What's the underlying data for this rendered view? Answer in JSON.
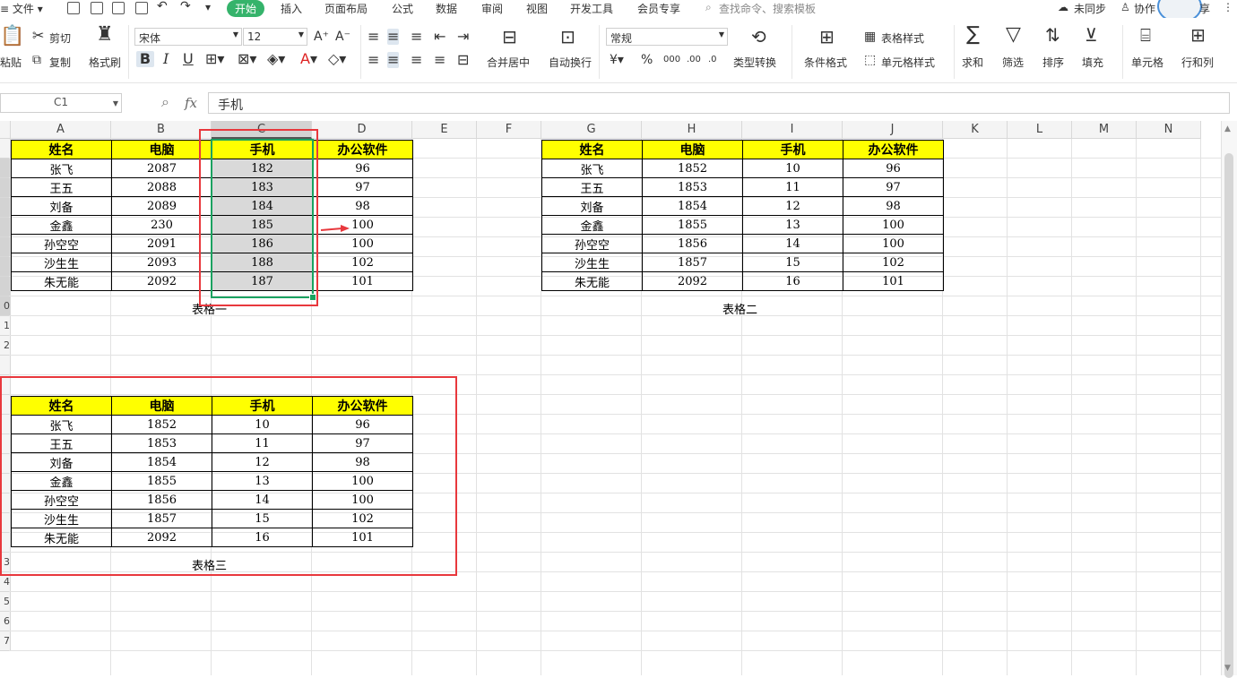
{
  "menubar": {
    "file": "文件",
    "tabs": [
      "开始",
      "插入",
      "页面布局",
      "公式",
      "数据",
      "审阅",
      "视图",
      "开发工具",
      "会员专享"
    ],
    "search_placeholder": "查找命令、搜索模板",
    "sync": "未同步",
    "collab": "协作",
    "more": "享"
  },
  "ribbon": {
    "cut": "剪切",
    "paste": "粘贴",
    "copy": "复制",
    "format_painter": "格式刷",
    "font_name": "宋体",
    "font_size": "12",
    "merge_center": "合并居中",
    "wrap": "自动换行",
    "number_format": "常规",
    "type_convert": "类型转换",
    "cond_format": "条件格式",
    "table_style": "表格样式",
    "cell_style": "单元格样式",
    "sum": "求和",
    "filter": "筛选",
    "sort": "排序",
    "fill": "填充",
    "cell": "单元格",
    "row_col": "行和列"
  },
  "formula_bar": {
    "cell_ref": "C1",
    "fx": "fx",
    "content": "手机"
  },
  "columns": [
    "A",
    "B",
    "C",
    "D",
    "E",
    "F",
    "G",
    "H",
    "I",
    "J",
    "K",
    "L",
    "M",
    "N"
  ],
  "row_labels": [
    "",
    "",
    "",
    "",
    "",
    "",
    "",
    "",
    "0",
    "1",
    "2",
    "",
    "",
    "",
    "",
    "",
    "",
    "",
    "",
    "",
    "",
    "3",
    "4",
    "5",
    "6",
    "7"
  ],
  "headers": [
    "姓名",
    "电脑",
    "手机",
    "办公软件"
  ],
  "table1": {
    "caption": "表格一",
    "rows": [
      [
        "张飞",
        "2087",
        "182",
        "96"
      ],
      [
        "王五",
        "2088",
        "183",
        "97"
      ],
      [
        "刘备",
        "2089",
        "184",
        "98"
      ],
      [
        "金鑫",
        "230",
        "185",
        "100"
      ],
      [
        "孙空空",
        "2091",
        "186",
        "100"
      ],
      [
        "沙生生",
        "2093",
        "188",
        "102"
      ],
      [
        "朱无能",
        "2092",
        "187",
        "101"
      ]
    ]
  },
  "table2": {
    "caption": "表格二",
    "rows": [
      [
        "张飞",
        "1852",
        "10",
        "96"
      ],
      [
        "王五",
        "1853",
        "11",
        "97"
      ],
      [
        "刘备",
        "1854",
        "12",
        "98"
      ],
      [
        "金鑫",
        "1855",
        "13",
        "100"
      ],
      [
        "孙空空",
        "1856",
        "14",
        "100"
      ],
      [
        "沙生生",
        "1857",
        "15",
        "102"
      ],
      [
        "朱无能",
        "2092",
        "16",
        "101"
      ]
    ]
  },
  "table3": {
    "caption": "表格三",
    "rows": [
      [
        "张飞",
        "1852",
        "10",
        "96"
      ],
      [
        "王五",
        "1853",
        "11",
        "97"
      ],
      [
        "刘备",
        "1854",
        "12",
        "98"
      ],
      [
        "金鑫",
        "1855",
        "13",
        "100"
      ],
      [
        "孙空空",
        "1856",
        "14",
        "100"
      ],
      [
        "沙生生",
        "1857",
        "15",
        "102"
      ],
      [
        "朱无能",
        "2092",
        "16",
        "101"
      ]
    ]
  },
  "colors": {
    "accent": "#35b36b",
    "header_fill": "#ffff00",
    "annotation_red": "#e8383d",
    "selection_green": "#1aa260"
  }
}
